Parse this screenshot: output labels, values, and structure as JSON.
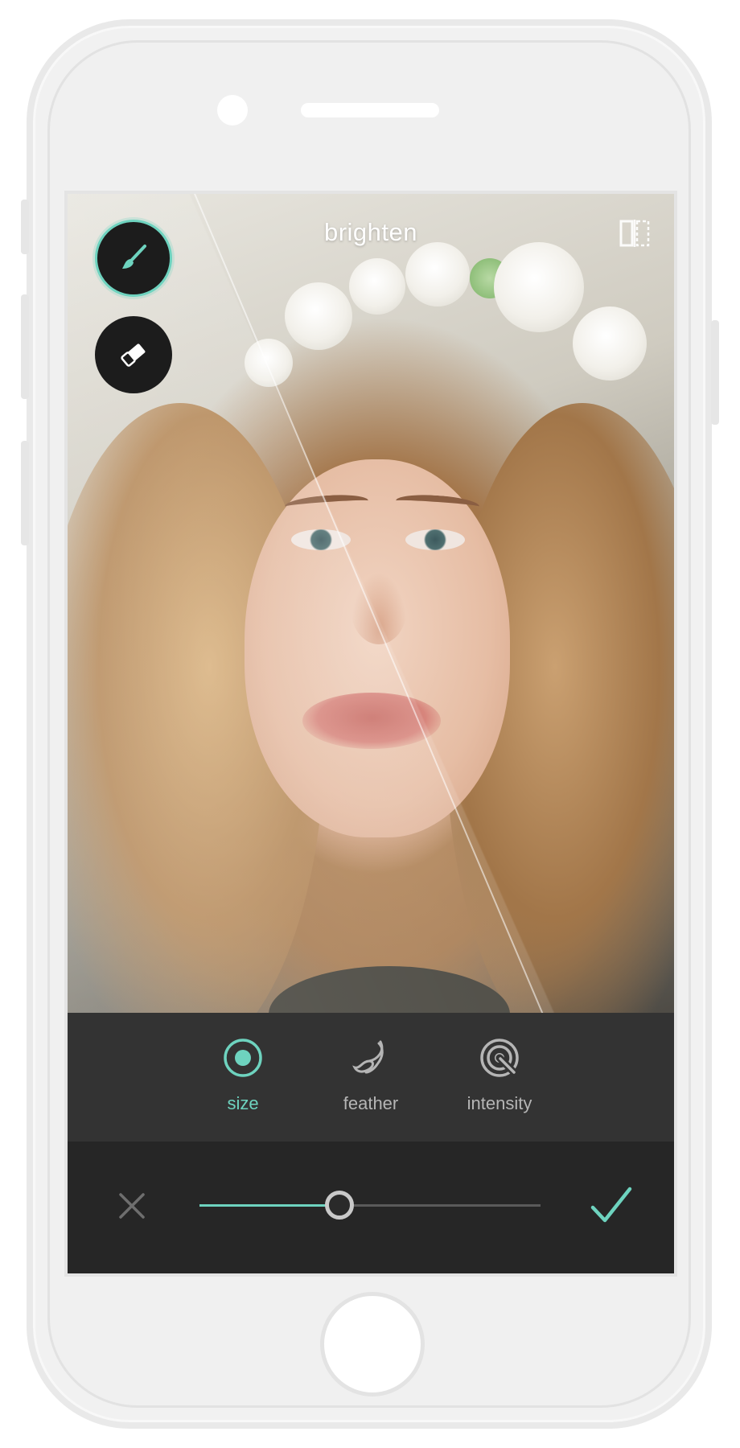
{
  "screen": {
    "title": "brighten"
  },
  "tools": {
    "brush_icon": "paintbrush-icon",
    "eraser_icon": "eraser-icon",
    "compare_icon": "compare-split-icon"
  },
  "options": [
    {
      "label": "size",
      "icon": "size-target-icon",
      "active": true
    },
    {
      "label": "feather",
      "icon": "feather-icon",
      "active": false
    },
    {
      "label": "intensity",
      "icon": "intensity-icon",
      "active": false
    }
  ],
  "slider": {
    "value": 0.41
  },
  "actions": {
    "cancel_icon": "close-icon",
    "confirm_icon": "checkmark-icon"
  },
  "colors": {
    "accent": "#6ed3bf",
    "toolbar_dark": "#262626",
    "toolbar_mid": "#333333",
    "inactive_label": "#b5b5b5"
  }
}
